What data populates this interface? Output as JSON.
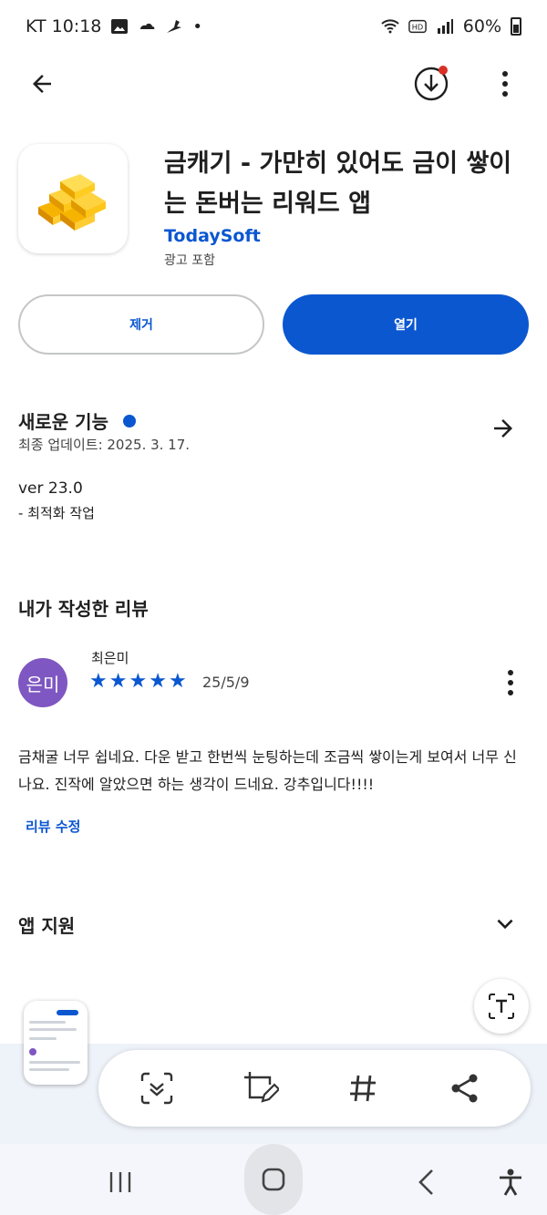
{
  "status_bar": {
    "carrier_time": "KT 10:18",
    "battery": "60%"
  },
  "app_bar": {
    "back_icon": "arrow-back-icon",
    "download_icon": "download-icon",
    "more_icon": "more-vert-icon"
  },
  "app": {
    "title": "금캐기 - 가만히 있어도 금이 쌓이는 돈버는 리워드 앱",
    "developer": "TodaySoft",
    "ads_label": "광고 포함"
  },
  "actions": {
    "remove_label": "제거",
    "open_label": "열기"
  },
  "whats_new": {
    "title": "새로운 기능",
    "updated": "최종 업데이트: 2025. 3. 17.",
    "version": "ver 23.0",
    "note": "- 최적화 작업"
  },
  "my_review": {
    "title": "내가 작성한 리뷰",
    "avatar_text": "은미",
    "reviewer": "최은미",
    "rating": 5,
    "stars": [
      "★",
      "★",
      "★",
      "★",
      "★"
    ],
    "date": "25/5/9",
    "text": "금채굴 너무 쉽네요. 다운 받고 한번씩 눈팅하는데 조금씩 쌓이는게 보여서 너무 신나요. 진작에 알았으면 하는 생각이 드네요. 강추입니다!!!!",
    "edit_label": "리뷰 수정"
  },
  "app_support": {
    "title": "앱 지원"
  },
  "colors": {
    "accent": "#0b57d0",
    "avatar": "#7e57c2",
    "badge": "#d93025"
  }
}
